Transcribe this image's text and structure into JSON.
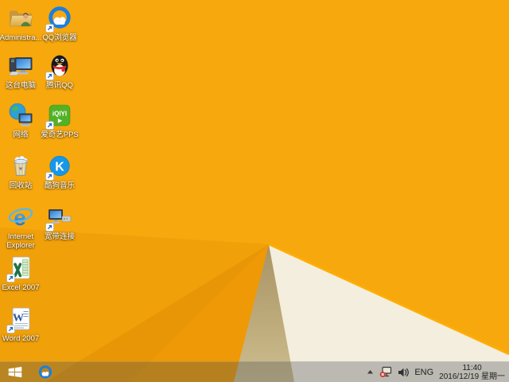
{
  "wallpaper": {
    "base_orange": "#F7A80D",
    "facet_left_upper": "#F0A009",
    "facet_left_mid": "#E89606",
    "facet_left_lower": "#EE9905",
    "tan_top": "#A89363",
    "tan_bottom": "#CDBD8E",
    "cream": "#F3EEDE",
    "edge_highlight": "#FFAE06"
  },
  "desktop": {
    "icons": [
      {
        "label": "Administra..."
      },
      {
        "label": "QQ浏览器"
      },
      {
        "label": "这台电脑"
      },
      {
        "label": "腾讯QQ"
      },
      {
        "label": "网络"
      },
      {
        "label": "爱奇艺PPS",
        "logo_text": "iQIYI"
      },
      {
        "label": "回收站"
      },
      {
        "label": "酷狗音乐",
        "logo_text": "K"
      },
      {
        "label": "Internet Explorer",
        "logo_text": "e"
      },
      {
        "label": "宽带连接"
      },
      {
        "label": "Excel 2007"
      },
      {
        "label": "Word 2007",
        "logo_text": "W"
      }
    ]
  },
  "taskbar": {
    "start_icon": "windows-logo",
    "pinned_apps": [
      "qq-browser"
    ],
    "tray_icons": [
      "show-hidden-arrow",
      "network-disconnected",
      "volume"
    ],
    "tray": {
      "language": "ENG",
      "time": "11:40",
      "date": "2016/12/19 星期一"
    }
  }
}
